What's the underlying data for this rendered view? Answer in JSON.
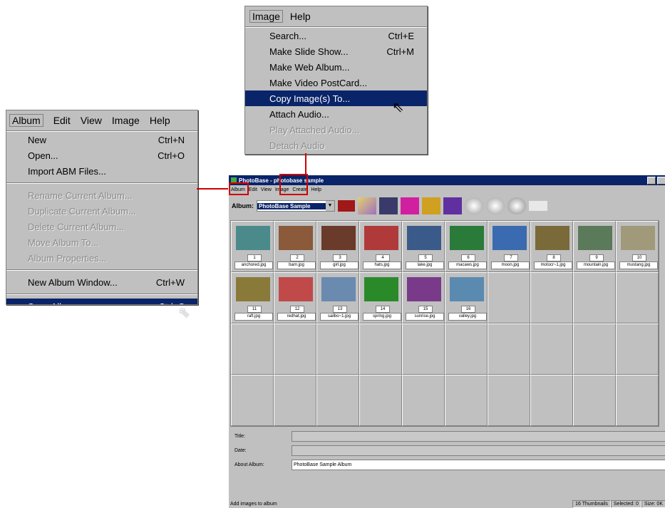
{
  "album_menu": {
    "bar": [
      "Album",
      "Edit",
      "View",
      "Image",
      "Help"
    ],
    "items": [
      {
        "label": "New",
        "shortcut": "Ctrl+N",
        "state": "normal"
      },
      {
        "label": "Open...",
        "shortcut": "Ctrl+O",
        "state": "normal"
      },
      {
        "label": "Import ABM Files...",
        "shortcut": "",
        "state": "normal"
      },
      {
        "sep": true
      },
      {
        "label": "Rename Current Album...",
        "shortcut": "",
        "state": "disabled"
      },
      {
        "label": "Duplicate Current Album...",
        "shortcut": "",
        "state": "disabled"
      },
      {
        "label": "Delete Current Album...",
        "shortcut": "",
        "state": "disabled"
      },
      {
        "label": "Move Album To...",
        "shortcut": "",
        "state": "disabled"
      },
      {
        "label": "Album Properties...",
        "shortcut": "",
        "state": "disabled"
      },
      {
        "sep": true
      },
      {
        "label": "New Album Window...",
        "shortcut": "Ctrl+W",
        "state": "normal"
      },
      {
        "sep": true
      },
      {
        "label": "Save Album",
        "shortcut": "Ctrl+S",
        "state": "selected"
      }
    ]
  },
  "image_menu": {
    "bar": [
      "Image",
      "Help"
    ],
    "items": [
      {
        "label": "Search...",
        "shortcut": "Ctrl+E",
        "state": "normal"
      },
      {
        "label": "Make Slide Show...",
        "shortcut": "Ctrl+M",
        "state": "normal"
      },
      {
        "label": "Make Web Album...",
        "shortcut": "",
        "state": "normal"
      },
      {
        "label": "Make Video PostCard...",
        "shortcut": "",
        "state": "normal"
      },
      {
        "label": "Copy Image(s) To...",
        "shortcut": "",
        "state": "selected"
      },
      {
        "label": "Attach Audio...",
        "shortcut": "",
        "state": "normal"
      },
      {
        "label": "Play Attached Audio...",
        "shortcut": "",
        "state": "disabled"
      },
      {
        "label": "Detach Audio",
        "shortcut": "",
        "state": "disabled"
      }
    ]
  },
  "app": {
    "title": "PhotoBase - photobase sample",
    "menu": [
      "Album",
      "Edit",
      "View",
      "Image",
      "Create",
      "Help"
    ],
    "album_label": "Album:",
    "album_select": "PhotoBase Sample",
    "thumbnails": [
      {
        "n": "1",
        "file": "anchored.jpg",
        "color": "#4a8a8a"
      },
      {
        "n": "2",
        "file": "barn.jpg",
        "color": "#8a5a3a"
      },
      {
        "n": "3",
        "file": "girl.jpg",
        "color": "#6a3a2a"
      },
      {
        "n": "4",
        "file": "hats.jpg",
        "color": "#b03a3a"
      },
      {
        "n": "5",
        "file": "lake.jpg",
        "color": "#3a5a8a"
      },
      {
        "n": "6",
        "file": "macaws.jpg",
        "color": "#2a7a3a"
      },
      {
        "n": "7",
        "file": "moon.jpg",
        "color": "#3a6ab0"
      },
      {
        "n": "8",
        "file": "motocr~1.jpg",
        "color": "#7a6a3a"
      },
      {
        "n": "9",
        "file": "mountain.jpg",
        "color": "#5a7a5a"
      },
      {
        "n": "10",
        "file": "mustang.jpg",
        "color": "#a09a7a"
      },
      {
        "n": "11",
        "file": "raft.jpg",
        "color": "#8a7a3a"
      },
      {
        "n": "12",
        "file": "redhat.jpg",
        "color": "#c04a4a"
      },
      {
        "n": "13",
        "file": "sailbo~1.jpg",
        "color": "#6a8ab0"
      },
      {
        "n": "14",
        "file": "spring.jpg",
        "color": "#2a8a2a"
      },
      {
        "n": "15",
        "file": "sunrise.jpg",
        "color": "#7a3a8a"
      },
      {
        "n": "16",
        "file": "valley.jpg",
        "color": "#5a8ab0"
      }
    ],
    "fields": {
      "title_label": "Title:",
      "date_label": "Date:",
      "about_label": "About Album:",
      "about_value": "PhotoBase Sample Album"
    },
    "status": {
      "left": "Add images to album",
      "count": "16 Thumbnails",
      "selected": "Selected: 0",
      "size": "Size: 0K"
    }
  },
  "colors": {
    "highlight": "#0a246a",
    "connector": "#d00000",
    "menu_bg": "#c0c0c0"
  }
}
